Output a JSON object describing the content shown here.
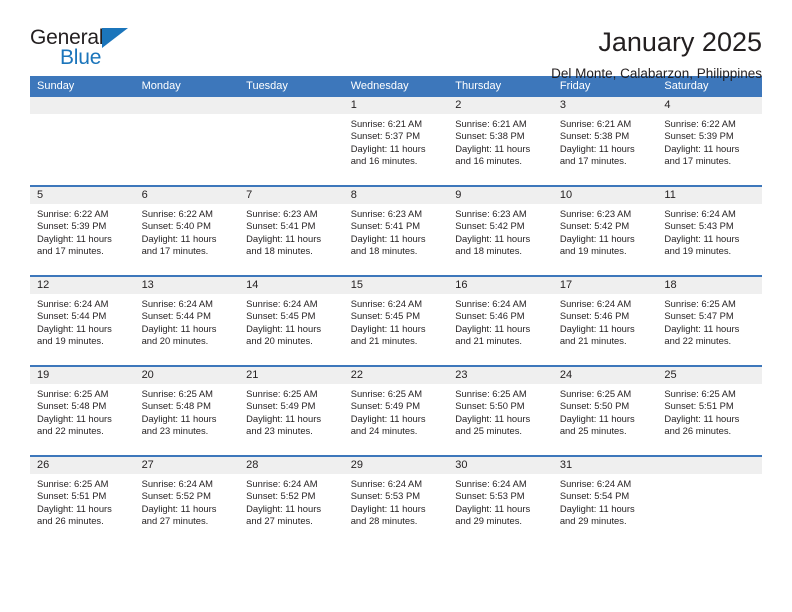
{
  "brand": {
    "name_top": "General",
    "name_bottom": "Blue",
    "accent_color": "#1b75bb"
  },
  "header": {
    "title": "January 2025",
    "subtitle": "Del Monte, Calabarzon, Philippines"
  },
  "calendar": {
    "header_bg": "#3d77bb",
    "day_number_bg": "#efefef",
    "weekdays": [
      "Sunday",
      "Monday",
      "Tuesday",
      "Wednesday",
      "Thursday",
      "Friday",
      "Saturday"
    ],
    "weeks": [
      [
        {
          "day": "",
          "empty": true
        },
        {
          "day": "",
          "empty": true
        },
        {
          "day": "",
          "empty": true
        },
        {
          "day": "1",
          "sunrise": "Sunrise: 6:21 AM",
          "sunset": "Sunset: 5:37 PM",
          "daylight": "Daylight: 11 hours and 16 minutes."
        },
        {
          "day": "2",
          "sunrise": "Sunrise: 6:21 AM",
          "sunset": "Sunset: 5:38 PM",
          "daylight": "Daylight: 11 hours and 16 minutes."
        },
        {
          "day": "3",
          "sunrise": "Sunrise: 6:21 AM",
          "sunset": "Sunset: 5:38 PM",
          "daylight": "Daylight: 11 hours and 17 minutes."
        },
        {
          "day": "4",
          "sunrise": "Sunrise: 6:22 AM",
          "sunset": "Sunset: 5:39 PM",
          "daylight": "Daylight: 11 hours and 17 minutes."
        }
      ],
      [
        {
          "day": "5",
          "sunrise": "Sunrise: 6:22 AM",
          "sunset": "Sunset: 5:39 PM",
          "daylight": "Daylight: 11 hours and 17 minutes."
        },
        {
          "day": "6",
          "sunrise": "Sunrise: 6:22 AM",
          "sunset": "Sunset: 5:40 PM",
          "daylight": "Daylight: 11 hours and 17 minutes."
        },
        {
          "day": "7",
          "sunrise": "Sunrise: 6:23 AM",
          "sunset": "Sunset: 5:41 PM",
          "daylight": "Daylight: 11 hours and 18 minutes."
        },
        {
          "day": "8",
          "sunrise": "Sunrise: 6:23 AM",
          "sunset": "Sunset: 5:41 PM",
          "daylight": "Daylight: 11 hours and 18 minutes."
        },
        {
          "day": "9",
          "sunrise": "Sunrise: 6:23 AM",
          "sunset": "Sunset: 5:42 PM",
          "daylight": "Daylight: 11 hours and 18 minutes."
        },
        {
          "day": "10",
          "sunrise": "Sunrise: 6:23 AM",
          "sunset": "Sunset: 5:42 PM",
          "daylight": "Daylight: 11 hours and 19 minutes."
        },
        {
          "day": "11",
          "sunrise": "Sunrise: 6:24 AM",
          "sunset": "Sunset: 5:43 PM",
          "daylight": "Daylight: 11 hours and 19 minutes."
        }
      ],
      [
        {
          "day": "12",
          "sunrise": "Sunrise: 6:24 AM",
          "sunset": "Sunset: 5:44 PM",
          "daylight": "Daylight: 11 hours and 19 minutes."
        },
        {
          "day": "13",
          "sunrise": "Sunrise: 6:24 AM",
          "sunset": "Sunset: 5:44 PM",
          "daylight": "Daylight: 11 hours and 20 minutes."
        },
        {
          "day": "14",
          "sunrise": "Sunrise: 6:24 AM",
          "sunset": "Sunset: 5:45 PM",
          "daylight": "Daylight: 11 hours and 20 minutes."
        },
        {
          "day": "15",
          "sunrise": "Sunrise: 6:24 AM",
          "sunset": "Sunset: 5:45 PM",
          "daylight": "Daylight: 11 hours and 21 minutes."
        },
        {
          "day": "16",
          "sunrise": "Sunrise: 6:24 AM",
          "sunset": "Sunset: 5:46 PM",
          "daylight": "Daylight: 11 hours and 21 minutes."
        },
        {
          "day": "17",
          "sunrise": "Sunrise: 6:24 AM",
          "sunset": "Sunset: 5:46 PM",
          "daylight": "Daylight: 11 hours and 21 minutes."
        },
        {
          "day": "18",
          "sunrise": "Sunrise: 6:25 AM",
          "sunset": "Sunset: 5:47 PM",
          "daylight": "Daylight: 11 hours and 22 minutes."
        }
      ],
      [
        {
          "day": "19",
          "sunrise": "Sunrise: 6:25 AM",
          "sunset": "Sunset: 5:48 PM",
          "daylight": "Daylight: 11 hours and 22 minutes."
        },
        {
          "day": "20",
          "sunrise": "Sunrise: 6:25 AM",
          "sunset": "Sunset: 5:48 PM",
          "daylight": "Daylight: 11 hours and 23 minutes."
        },
        {
          "day": "21",
          "sunrise": "Sunrise: 6:25 AM",
          "sunset": "Sunset: 5:49 PM",
          "daylight": "Daylight: 11 hours and 23 minutes."
        },
        {
          "day": "22",
          "sunrise": "Sunrise: 6:25 AM",
          "sunset": "Sunset: 5:49 PM",
          "daylight": "Daylight: 11 hours and 24 minutes."
        },
        {
          "day": "23",
          "sunrise": "Sunrise: 6:25 AM",
          "sunset": "Sunset: 5:50 PM",
          "daylight": "Daylight: 11 hours and 25 minutes."
        },
        {
          "day": "24",
          "sunrise": "Sunrise: 6:25 AM",
          "sunset": "Sunset: 5:50 PM",
          "daylight": "Daylight: 11 hours and 25 minutes."
        },
        {
          "day": "25",
          "sunrise": "Sunrise: 6:25 AM",
          "sunset": "Sunset: 5:51 PM",
          "daylight": "Daylight: 11 hours and 26 minutes."
        }
      ],
      [
        {
          "day": "26",
          "sunrise": "Sunrise: 6:25 AM",
          "sunset": "Sunset: 5:51 PM",
          "daylight": "Daylight: 11 hours and 26 minutes."
        },
        {
          "day": "27",
          "sunrise": "Sunrise: 6:24 AM",
          "sunset": "Sunset: 5:52 PM",
          "daylight": "Daylight: 11 hours and 27 minutes."
        },
        {
          "day": "28",
          "sunrise": "Sunrise: 6:24 AM",
          "sunset": "Sunset: 5:52 PM",
          "daylight": "Daylight: 11 hours and 27 minutes."
        },
        {
          "day": "29",
          "sunrise": "Sunrise: 6:24 AM",
          "sunset": "Sunset: 5:53 PM",
          "daylight": "Daylight: 11 hours and 28 minutes."
        },
        {
          "day": "30",
          "sunrise": "Sunrise: 6:24 AM",
          "sunset": "Sunset: 5:53 PM",
          "daylight": "Daylight: 11 hours and 29 minutes."
        },
        {
          "day": "31",
          "sunrise": "Sunrise: 6:24 AM",
          "sunset": "Sunset: 5:54 PM",
          "daylight": "Daylight: 11 hours and 29 minutes."
        },
        {
          "day": "",
          "empty": true
        }
      ]
    ]
  }
}
